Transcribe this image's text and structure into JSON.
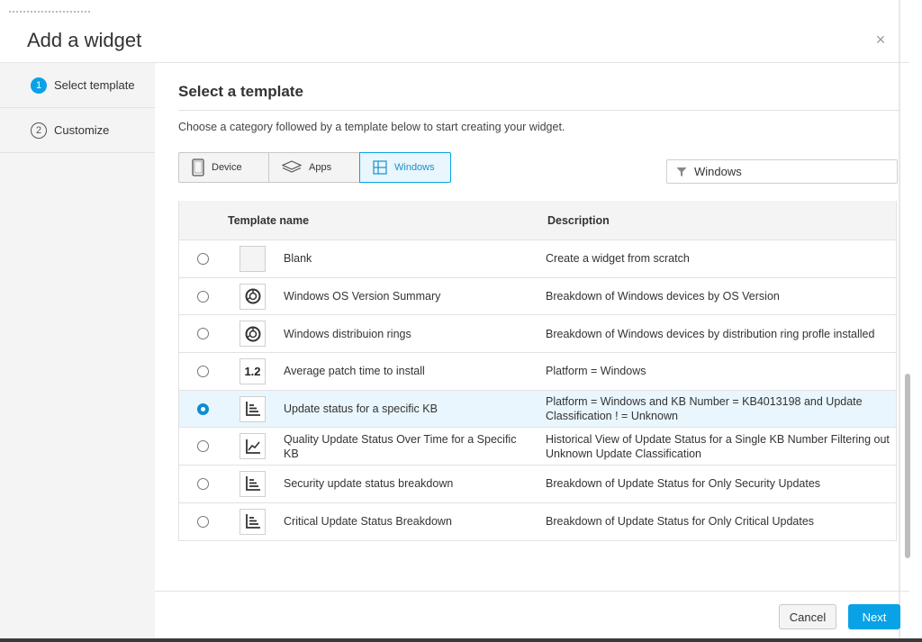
{
  "dialog": {
    "title": "Add a widget",
    "close_label": "×"
  },
  "steps": [
    {
      "number": "1",
      "label": "Select template",
      "active": true
    },
    {
      "number": "2",
      "label": "Customize",
      "active": false
    }
  ],
  "main": {
    "heading": "Select a template",
    "instructions": "Choose a category followed by a template below to start creating your widget."
  },
  "categories": [
    {
      "label": "Device",
      "icon": "tablet-icon",
      "active": false
    },
    {
      "label": "Apps",
      "icon": "layers-icon",
      "active": false
    },
    {
      "label": "Windows",
      "icon": "windows-icon",
      "active": true
    }
  ],
  "filter": {
    "value": "Windows",
    "icon": "filter-icon"
  },
  "table": {
    "columns": [
      "Template name",
      "Description"
    ],
    "rows": [
      {
        "name": "Blank",
        "description": "Create a widget from scratch",
        "thumb": "blank",
        "selected": false
      },
      {
        "name": "Windows OS Version Summary",
        "description": "Breakdown of Windows devices by OS Version",
        "thumb": "donut-chart-icon",
        "selected": false
      },
      {
        "name": "Windows distribuion rings",
        "description": "Breakdown of Windows devices by distribution ring profle installed",
        "thumb": "donut-chart-icon",
        "selected": false
      },
      {
        "name": "Average patch time to install",
        "description": "Platform = Windows",
        "thumb": "metric-icon",
        "thumb_text": "1.2",
        "selected": false
      },
      {
        "name": "Update status for a specific KB",
        "description": "Platform = Windows and KB Number = KB4013198 and Update Classification ! = Unknown",
        "thumb": "bar-chart-icon",
        "selected": true
      },
      {
        "name": "Quality Update Status Over Time for a Specific KB",
        "description": "Historical View of Update Status for a Single KB Number Filtering out Unknown Update Classification",
        "thumb": "line-chart-icon",
        "selected": false
      },
      {
        "name": "Security update status breakdown",
        "description": "Breakdown of Update Status for Only Security Updates",
        "thumb": "bar-chart-icon",
        "selected": false
      },
      {
        "name": "Critical Update Status Breakdown",
        "description": "Breakdown of Update Status for Only Critical Updates",
        "thumb": "bar-chart-icon",
        "selected": false
      }
    ]
  },
  "footer": {
    "cancel_label": "Cancel",
    "next_label": "Next"
  },
  "colors": {
    "accent": "#0aa2e6",
    "selected_row": "#e9f6fd",
    "sidebar_bg": "#f4f4f4"
  }
}
